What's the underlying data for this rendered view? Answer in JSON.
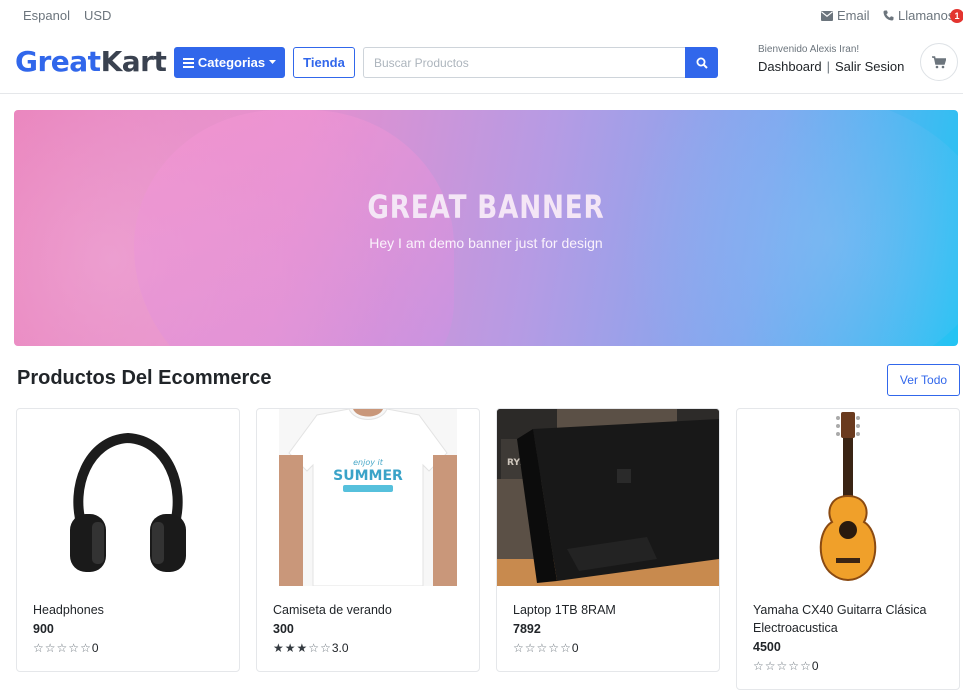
{
  "topbar": {
    "language": "Espanol",
    "currency": "USD",
    "email": "Email",
    "call": "Llamanos"
  },
  "header": {
    "logo_part1": "Great",
    "logo_part2": "Kart",
    "categories_label": "Categorias",
    "store_label": "Tienda",
    "search_placeholder": "Buscar Productos",
    "welcome": "Bienvenido Alexis Iran!",
    "dashboard": "Dashboard",
    "separator": "|",
    "logout": "Salir Sesion",
    "cart_count": "1"
  },
  "banner": {
    "title": "GREAT BANNER",
    "subtitle": "Hey I am demo banner just for design"
  },
  "products_section": {
    "title": "Productos Del Ecommerce",
    "view_all": "Ver Todo"
  },
  "products": [
    {
      "name": "Headphones",
      "price": "900",
      "rating_text": "0",
      "stars": 0,
      "image": "headphones"
    },
    {
      "name": "Camiseta de verando",
      "price": "300",
      "rating_text": "3.0",
      "stars": 3,
      "image": "tshirt"
    },
    {
      "name": "Laptop 1TB 8RAM",
      "price": "7892",
      "rating_text": "0",
      "stars": 0,
      "image": "laptop"
    },
    {
      "name": "Yamaha CX40 Guitarra Clásica Electroacustica",
      "price": "4500",
      "rating_text": "0",
      "stars": 0,
      "image": "guitar"
    }
  ],
  "colors": {
    "primary": "#3167eb",
    "badge": "#e3342f"
  }
}
